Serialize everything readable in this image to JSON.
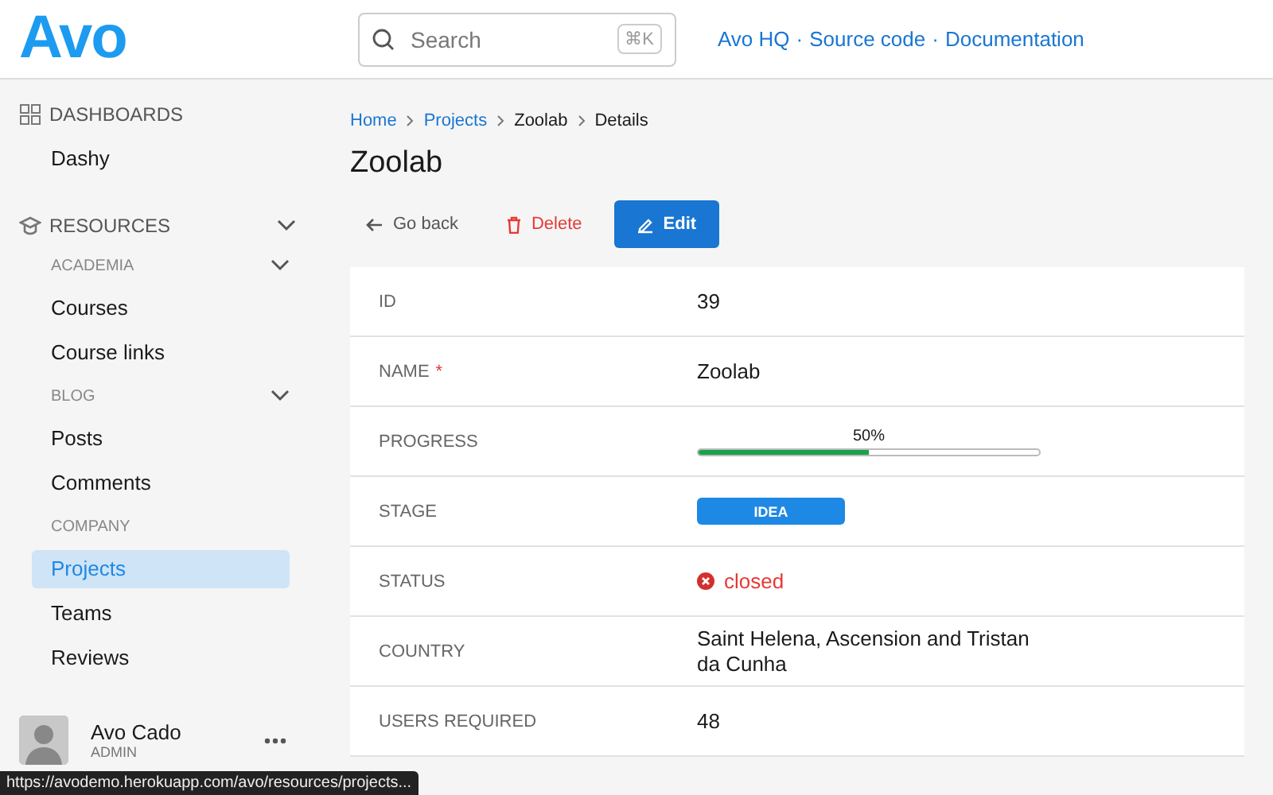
{
  "header": {
    "logo": "Avo",
    "search": {
      "placeholder": "Search",
      "shortcut": "⌘K"
    },
    "links": [
      "Avo HQ",
      "Source code",
      "Documentation"
    ],
    "separator": "·"
  },
  "sidebar": {
    "sections": [
      {
        "title": "DASHBOARDS",
        "collapsible": false,
        "groups": [
          {
            "items": [
              {
                "label": "Dashy",
                "selected": false
              }
            ]
          }
        ]
      },
      {
        "title": "RESOURCES",
        "collapsible": true,
        "groups": [
          {
            "title": "ACADEMIA",
            "collapsible": true,
            "items": [
              {
                "label": "Courses",
                "selected": false
              },
              {
                "label": "Course links",
                "selected": false
              }
            ]
          },
          {
            "title": "BLOG",
            "collapsible": true,
            "items": [
              {
                "label": "Posts",
                "selected": false
              },
              {
                "label": "Comments",
                "selected": false
              }
            ]
          },
          {
            "title": "COMPANY",
            "collapsible": false,
            "items": [
              {
                "label": "Projects",
                "selected": true
              },
              {
                "label": "Teams",
                "selected": false
              },
              {
                "label": "Reviews",
                "selected": false
              }
            ]
          }
        ]
      }
    ],
    "user": {
      "name": "Avo Cado",
      "role": "ADMIN"
    }
  },
  "breadcrumbs": [
    {
      "label": "Home",
      "link": true
    },
    {
      "label": "Projects",
      "link": true
    },
    {
      "label": "Zoolab",
      "link": false
    },
    {
      "label": "Details",
      "link": false
    }
  ],
  "title": "Zoolab",
  "actions": [
    {
      "label": "Go back",
      "kind": "back"
    },
    {
      "label": "Delete",
      "kind": "delete"
    },
    {
      "label": "Edit",
      "kind": "edit"
    }
  ],
  "fields": [
    {
      "label": "ID",
      "required": false,
      "kind": "text",
      "value": "39"
    },
    {
      "label": "NAME",
      "required": true,
      "required_mark": "*",
      "kind": "text",
      "value": "Zoolab"
    },
    {
      "label": "PROGRESS",
      "required": false,
      "kind": "progress",
      "value": "50%",
      "level": 0.5
    },
    {
      "label": "STAGE",
      "required": false,
      "kind": "badge",
      "value": "IDEA"
    },
    {
      "label": "STATUS",
      "required": false,
      "kind": "status",
      "value": "closed"
    },
    {
      "label": "COUNTRY",
      "required": false,
      "kind": "text",
      "value": "Saint Helena, Ascension and Tristan da Cunha"
    },
    {
      "label": "USERS REQUIRED",
      "required": false,
      "kind": "text",
      "value": "48"
    }
  ],
  "status_bar": {
    "url": "https://avodemo.herokuapp.com/avo/resources/projects..."
  }
}
